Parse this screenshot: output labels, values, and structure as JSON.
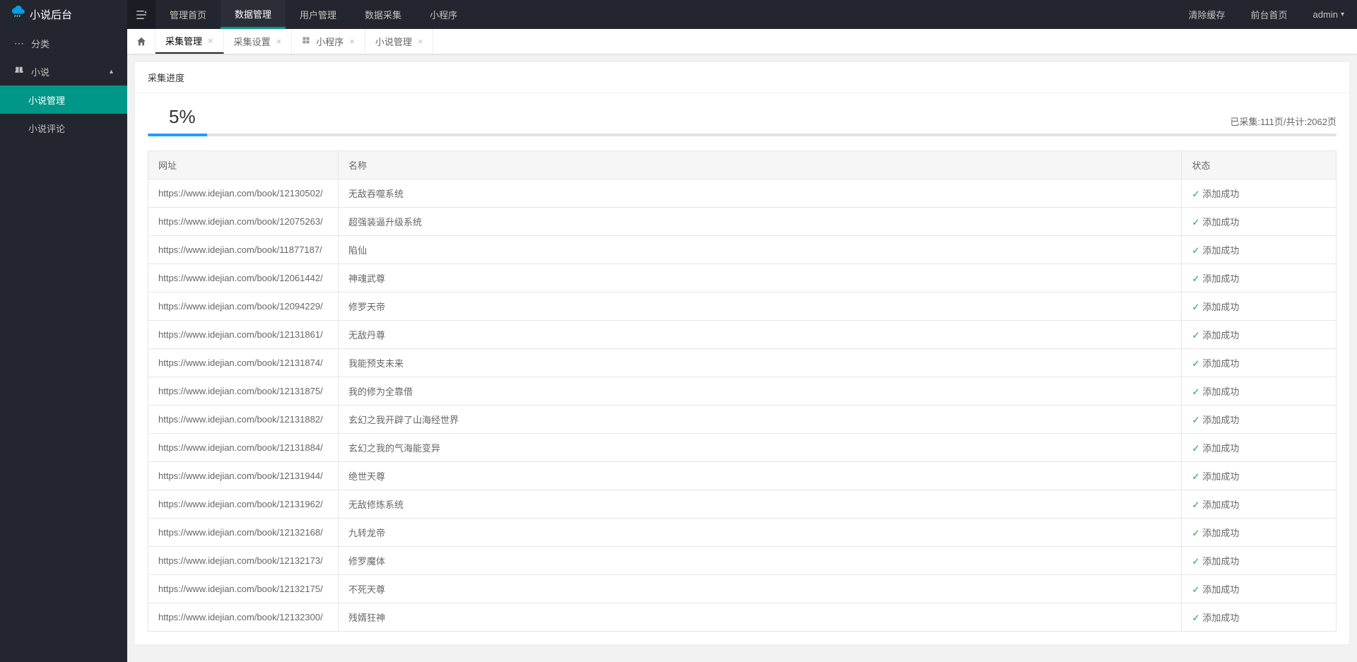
{
  "brand": {
    "name": "小说后台"
  },
  "topnav": {
    "items": [
      {
        "label": "管理首页"
      },
      {
        "label": "数据管理",
        "active": true
      },
      {
        "label": "用户管理"
      },
      {
        "label": "数据采集"
      },
      {
        "label": "小程序"
      }
    ]
  },
  "topright": {
    "clear_cache": "清除缓存",
    "frontend": "前台首页",
    "user": "admin"
  },
  "sidebar": {
    "category": "分类",
    "novel": "小说",
    "items": [
      {
        "label": "小说管理",
        "active": true
      },
      {
        "label": "小说评论"
      }
    ]
  },
  "tabs": [
    {
      "label": "采集管理",
      "active": true,
      "closable": true
    },
    {
      "label": "采集设置",
      "closable": true
    },
    {
      "label": "小程序",
      "closable": true,
      "icon": true
    },
    {
      "label": "小说管理",
      "closable": true
    }
  ],
  "card": {
    "title": "采集进度"
  },
  "progress": {
    "percent_text": "5%",
    "percent": 5,
    "stats": "已采集:111页/共计:2062页"
  },
  "table": {
    "headers": {
      "url": "网址",
      "name": "名称",
      "status": "状态"
    },
    "success_text": "添加成功",
    "rows": [
      {
        "url": "https://www.idejian.com/book/12130502/",
        "name": "无敌吞噬系统"
      },
      {
        "url": "https://www.idejian.com/book/12075263/",
        "name": "超强装逼升级系统"
      },
      {
        "url": "https://www.idejian.com/book/11877187/",
        "name": "陷仙"
      },
      {
        "url": "https://www.idejian.com/book/12061442/",
        "name": "神魂武尊"
      },
      {
        "url": "https://www.idejian.com/book/12094229/",
        "name": "修罗天帝"
      },
      {
        "url": "https://www.idejian.com/book/12131861/",
        "name": "无敌丹尊"
      },
      {
        "url": "https://www.idejian.com/book/12131874/",
        "name": "我能预支未来"
      },
      {
        "url": "https://www.idejian.com/book/12131875/",
        "name": "我的修为全靠借"
      },
      {
        "url": "https://www.idejian.com/book/12131882/",
        "name": "玄幻之我开辟了山海经世界"
      },
      {
        "url": "https://www.idejian.com/book/12131884/",
        "name": "玄幻之我的气海能变异"
      },
      {
        "url": "https://www.idejian.com/book/12131944/",
        "name": "绝世天尊"
      },
      {
        "url": "https://www.idejian.com/book/12131962/",
        "name": "无敌修炼系统"
      },
      {
        "url": "https://www.idejian.com/book/12132168/",
        "name": "九转龙帝"
      },
      {
        "url": "https://www.idejian.com/book/12132173/",
        "name": "修罗魔体"
      },
      {
        "url": "https://www.idejian.com/book/12132175/",
        "name": "不死天尊"
      },
      {
        "url": "https://www.idejian.com/book/12132300/",
        "name": "残婿狂神"
      }
    ]
  }
}
